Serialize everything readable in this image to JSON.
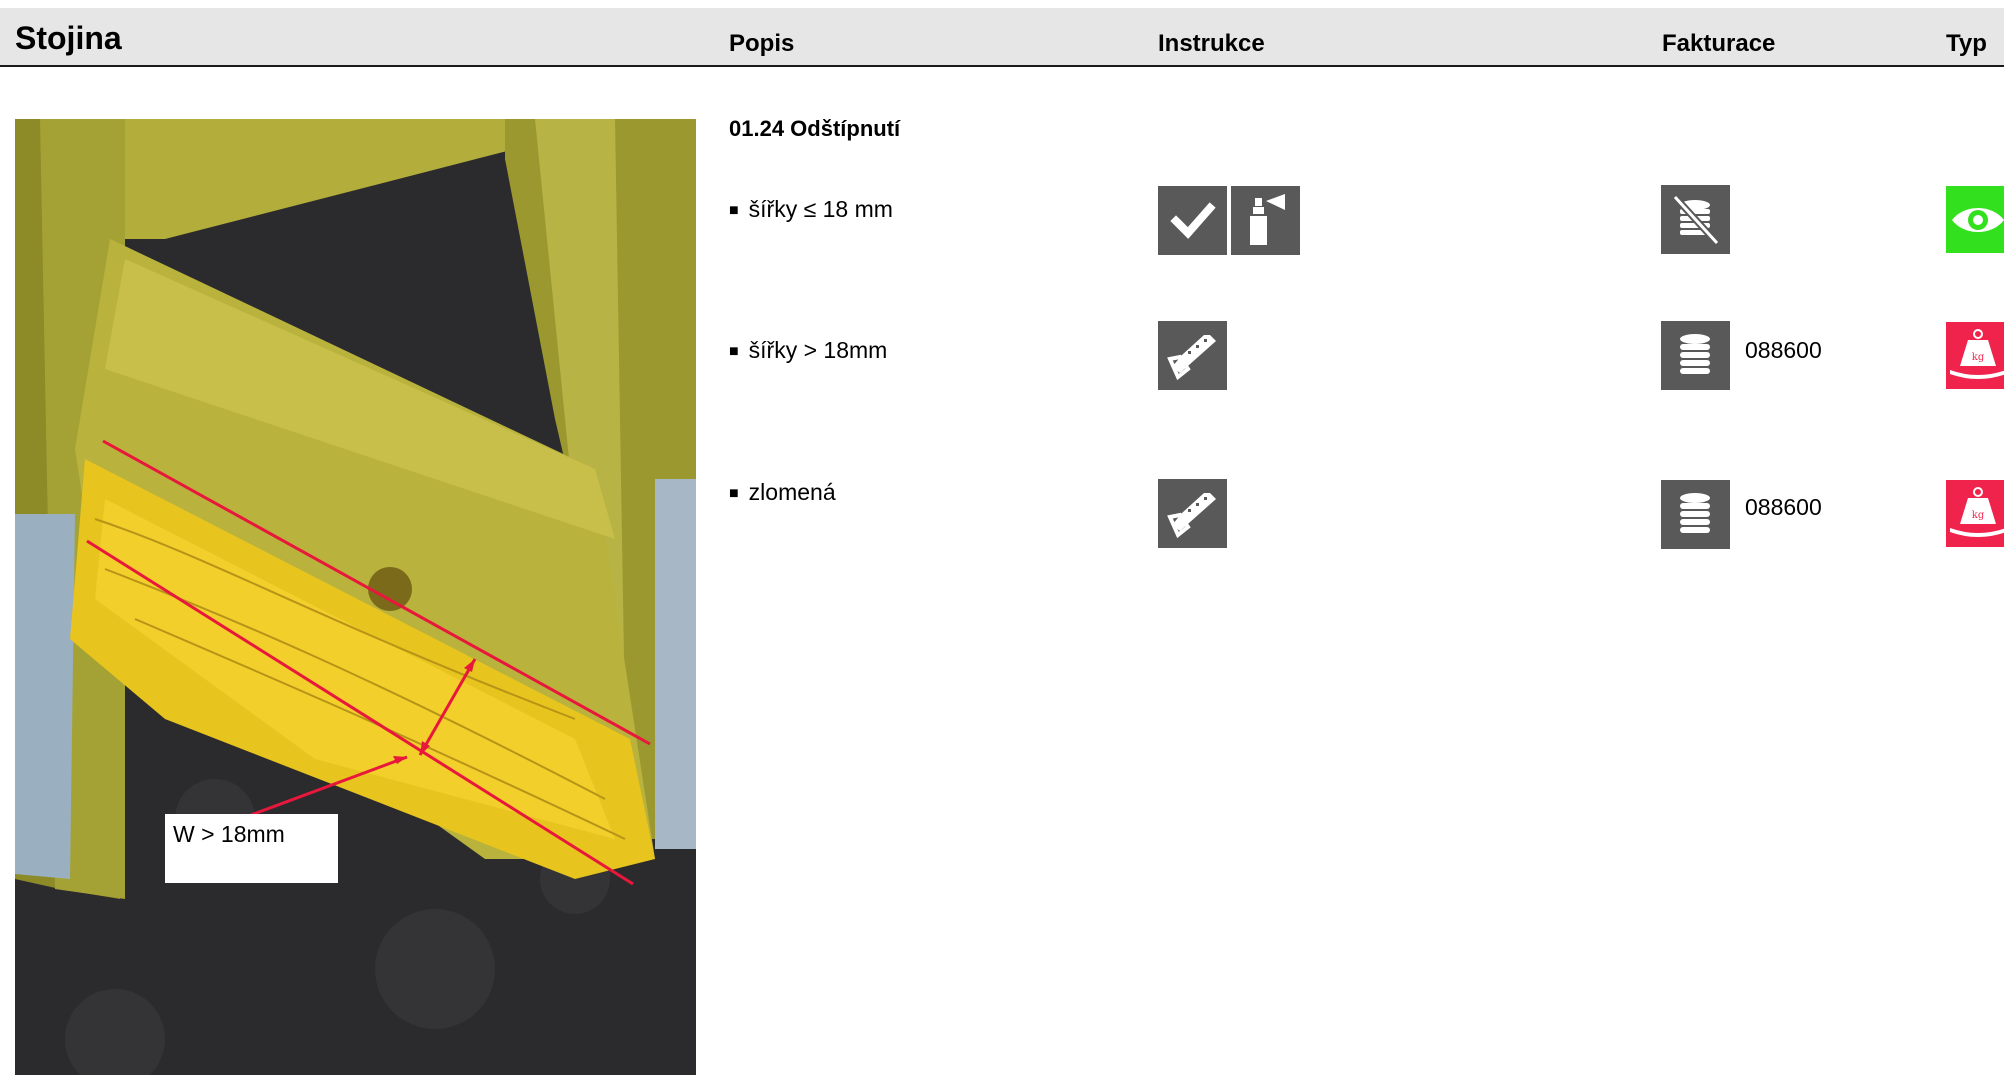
{
  "header": {
    "title": "Stojina",
    "columns": {
      "popis": "Popis",
      "instrukce": "Instrukce",
      "fakturace": "Fakturace",
      "typ": "Typ"
    }
  },
  "photo": {
    "annotation": "W > 18mm"
  },
  "section": {
    "title": "01.24 Odštípnutí"
  },
  "rows": [
    {
      "label": "šířky ≤ 18 mm",
      "instructions": [
        "check-icon",
        "spray-can-icon"
      ],
      "billing_icon": "coins-crossed-icon",
      "billing_code": "",
      "type_icon": "eye-icon",
      "type_color": "#33e01e"
    },
    {
      "label": "šířky > 18mm",
      "instructions": [
        "saw-icon"
      ],
      "billing_icon": "coins-icon",
      "billing_code": "088600",
      "type_icon": "weight-kg-icon",
      "type_color": "#f0234d"
    },
    {
      "label": "zlomená",
      "instructions": [
        "saw-icon"
      ],
      "billing_icon": "coins-icon",
      "billing_code": "088600",
      "type_icon": "weight-kg-icon",
      "type_color": "#f0234d"
    }
  ],
  "colors": {
    "header_bg": "#e6e6e6",
    "icon_bg": "#595959",
    "ok_green": "#33e01e",
    "scrap_red": "#f0234d",
    "annotation_red": "#e8173c"
  }
}
